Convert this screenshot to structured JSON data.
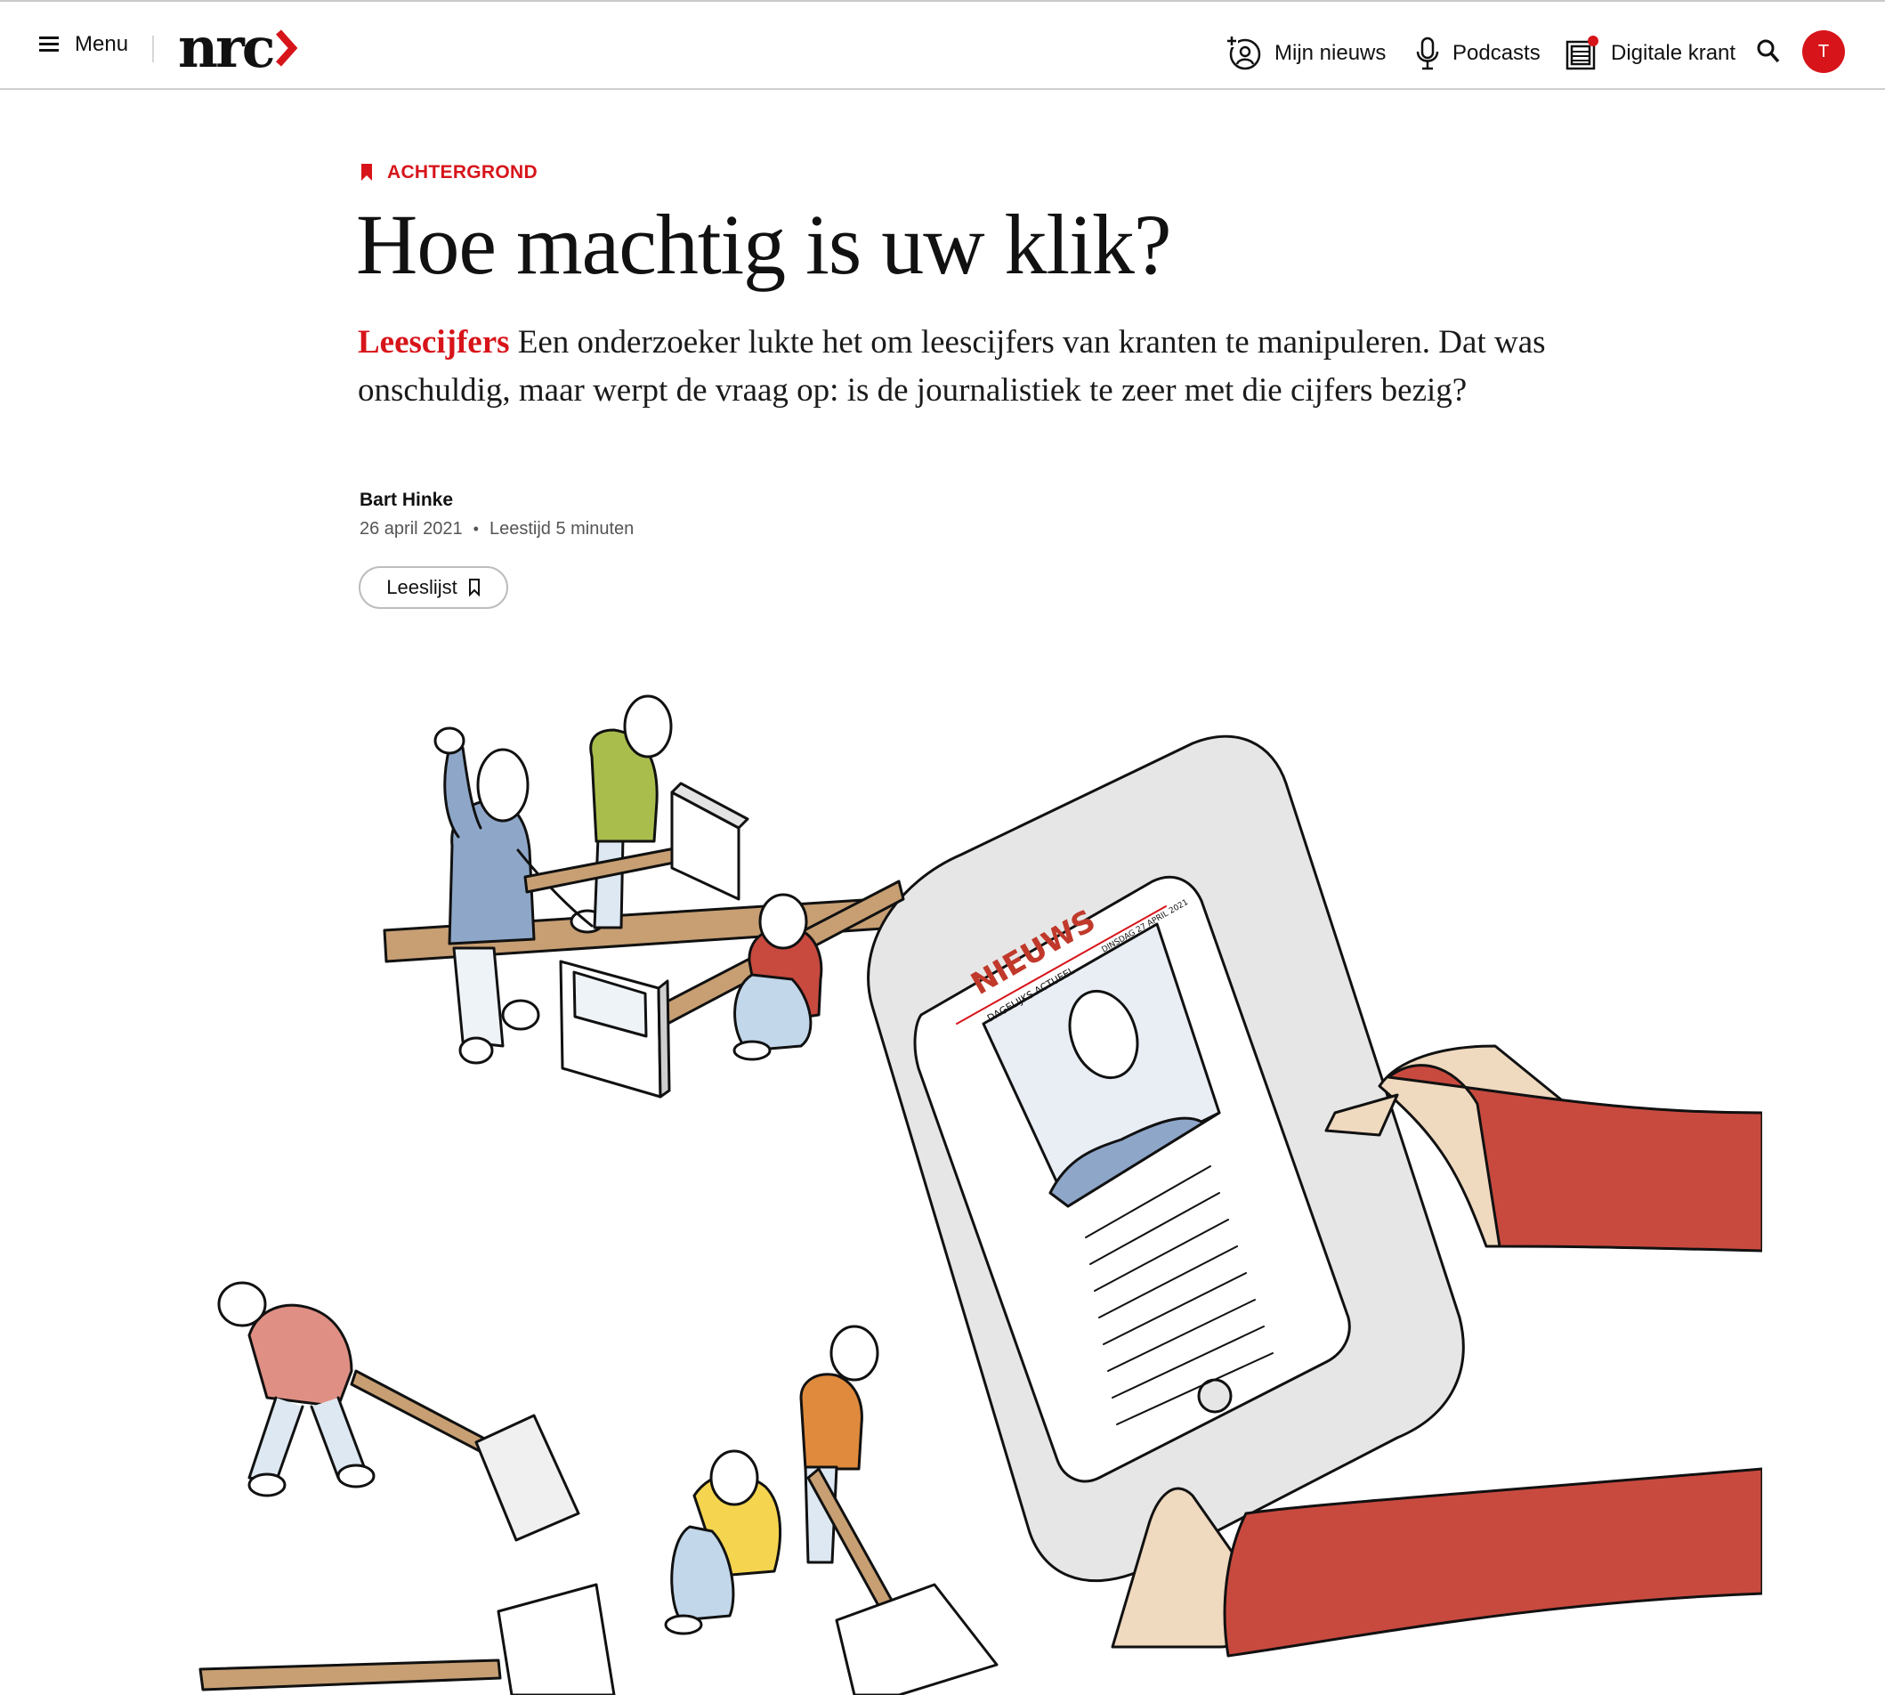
{
  "header": {
    "menu_label": "Menu",
    "logo_text": "nrc",
    "nav": [
      {
        "label": "Mijn nieuws",
        "icon": "personal-news-icon"
      },
      {
        "label": "Podcasts",
        "icon": "microphone-icon"
      },
      {
        "label": "Digitale krant",
        "icon": "newspaper-icon"
      }
    ],
    "avatar_letter": "T",
    "accent": "#d7141a"
  },
  "article": {
    "kicker": "ACHTERGROND",
    "title": "Hoe machtig is uw klik?",
    "lead_category": "Leescijfers",
    "lead_text": "Een onderzoeker lukte het om leescijfers van kranten te manipuleren. Dat was onschuldig, maar werpt de vraag op: is de journalistiek te zeer met die cijfers bezig?",
    "author": "Bart Hinke",
    "date": "26 april 2021",
    "reading_time": "Leestijd 5 minuten",
    "readlist_label": "Leeslijst"
  },
  "illustration": {
    "tablet_masthead": "NIEUWS",
    "tablet_subtitle": "DAGELIJKS ACTUEEL",
    "tablet_date": "DINSDAG 27 APRIL 2021"
  }
}
